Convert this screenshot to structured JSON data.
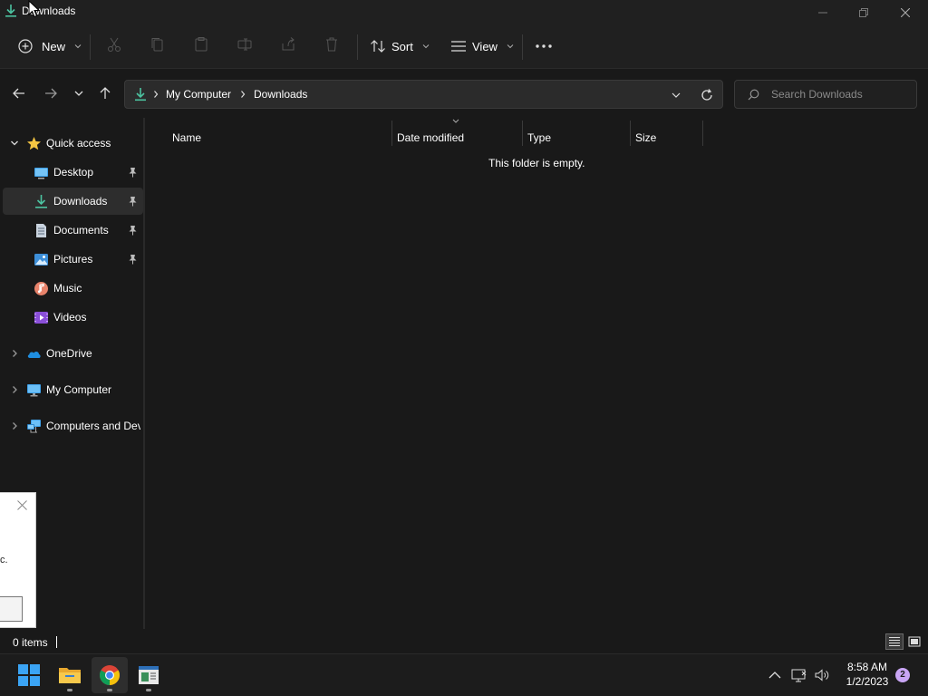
{
  "window": {
    "title": "Downloads"
  },
  "toolbar": {
    "new_label": "New",
    "sort_label": "Sort",
    "view_label": "View"
  },
  "address": {
    "crumbs": [
      "My Computer",
      "Downloads"
    ]
  },
  "search": {
    "placeholder": "Search Downloads"
  },
  "sidebar": {
    "items": [
      {
        "label": "Quick access",
        "icon": "star-icon"
      },
      {
        "label": "Desktop",
        "icon": "desktop-icon",
        "pinned": true
      },
      {
        "label": "Downloads",
        "icon": "download-icon",
        "pinned": true,
        "selected": true
      },
      {
        "label": "Documents",
        "icon": "document-icon",
        "pinned": true
      },
      {
        "label": "Pictures",
        "icon": "pictures-icon",
        "pinned": true
      },
      {
        "label": "Music",
        "icon": "music-icon"
      },
      {
        "label": "Videos",
        "icon": "videos-icon"
      },
      {
        "label": "OneDrive",
        "icon": "cloud-icon"
      },
      {
        "label": "My Computer",
        "icon": "monitor-icon"
      },
      {
        "label": "Computers and Devices",
        "icon": "network-icon"
      }
    ]
  },
  "content": {
    "columns": [
      "Name",
      "Date modified",
      "Type",
      "Size"
    ],
    "empty_message": "This folder is empty."
  },
  "notification": {
    "text": "c."
  },
  "status": {
    "item_count": "0 items"
  },
  "taskbar": {
    "time": "8:58 AM",
    "date": "1/2/2023",
    "notification_count": "2"
  },
  "colors": {
    "background": "#191919",
    "chrome": "#202020",
    "download_green": "#4cc2a0",
    "folder_yellow": "#f4c542",
    "accent_blue": "#4aa3f0"
  }
}
